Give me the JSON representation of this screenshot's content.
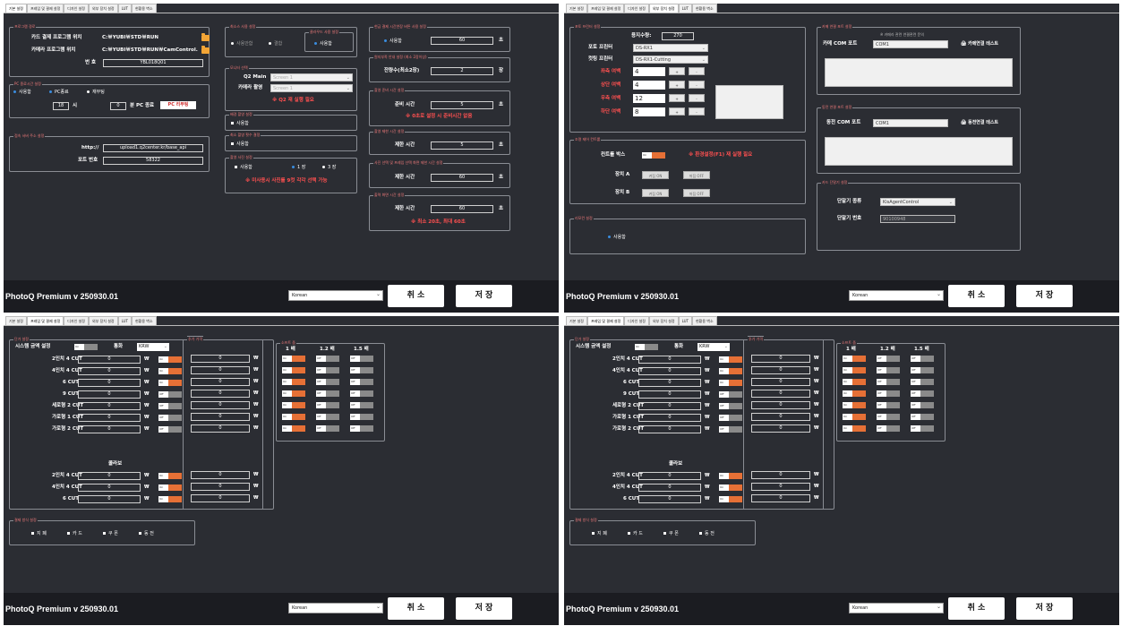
{
  "tabs": [
    "기본 설정",
    "프레임 및 결제 설정",
    "디자인 설정",
    "외부 장치 설정",
    "LUT",
    "현황용 벽소"
  ],
  "footer": {
    "version": "PhotoQ Premium v 250930.01",
    "language": "Korean",
    "cancel": "취 소",
    "save": "저 장"
  },
  "q1": {
    "program": {
      "title": "프로그램 경로",
      "card_label": "카드 결제 프로그램 위치",
      "card_path": "C:￦YUBI￦STD￦RUN",
      "camera_label": "카메라 프로그램 위치",
      "camera_path": "C:￦YUBI￦STD￦RUN￦CamControl.",
      "number_label": "번 호",
      "number_value": "YBL018Q01"
    },
    "pc": {
      "title": "PC 종료시간 설정",
      "use": "사용함",
      "shutdown": "PC종료",
      "reboot": "재부팅",
      "hour": "18",
      "hour_unit": "시",
      "min": "0",
      "min_unit": "분 PC 종료",
      "reboot_btn": "PC 리부팅"
    },
    "server": {
      "title": "접속 서버 주소 설정",
      "http_label": "http://",
      "url": "upload1.q2center.kr/base_api",
      "port_label": "포트 번호",
      "port": "58322"
    },
    "cut_photo": {
      "title": "최소스 사용 설정",
      "opt1": "사용안함",
      "opt2": "결합",
      "sub_title": "클라우드 사용 설정",
      "sub_opt": "사용함"
    },
    "monitor": {
      "title": "모니터 선택",
      "main_label": "Q2 Main",
      "main_value": "Screen 1",
      "camera_label": "카메라 촬영",
      "camera_value": "Screen 1",
      "warn": "※ Q2 재 실행 필요"
    },
    "bg": {
      "title": "배경 촬영 설정",
      "opt": "사용함"
    },
    "min_count": {
      "title": "최소 촬영 횟수 결정",
      "opt": "사용함"
    },
    "shoot": {
      "title": "촬영 사진 설정",
      "use": "사용함",
      "one": "1 장",
      "three": "3 장",
      "warn": "※ 미사용시 사진를 9컷 각각 선택 가능"
    },
    "cash": {
      "title": "현금 결제 시간연장 버튼 사용 설정",
      "use": "사용함",
      "value": "60",
      "unit": "초"
    },
    "paper": {
      "title": "원지부족 안내 설정 (최소 2장이상)",
      "label": "잔량수(최소2장)",
      "value": "2",
      "unit": "장"
    },
    "prep": {
      "title": "촬영 준비 시간 설정",
      "label": "준비 시간",
      "value": "5",
      "unit": "초",
      "warn": "※ 0초로 설정 시 준비시간 없음"
    },
    "limit": {
      "title": "촬영 제한 시간 설정",
      "label": "제한 시간",
      "value": "5",
      "unit": "초"
    },
    "select": {
      "title": "사진 선택 및 프레임 선택 화면 제한 시간 설정",
      "label": "제한 시간",
      "value": "60",
      "unit": "초"
    },
    "print": {
      "title": "출력 화면 시간 설정",
      "label": "제한 시간",
      "value": "60",
      "unit": "초",
      "warn": "※ 최소 20초, 최대 60초"
    }
  },
  "q2": {
    "photo": {
      "title": "포토 프린터 설정",
      "qty_label": "용지수량:",
      "qty": "270",
      "photo_printer_label": "포토 프린터",
      "photo_printer": "DS-RX1",
      "cut_printer_label": "컷팅 프린터",
      "cut_printer": "DS-RX1-Cutting",
      "margins": [
        {
          "label": "좌측 여백",
          "value": "4"
        },
        {
          "label": "상단 여백",
          "value": "4"
        },
        {
          "label": "우측 여백",
          "value": "12"
        },
        {
          "label": "하단 여백",
          "value": "8"
        }
      ],
      "plus": "+",
      "minus": "-"
    },
    "light": {
      "title": "조명 제어 컨트롤",
      "box_label": "컨트롤 박스",
      "warn": "※ 환경설정(F1) 재 실행 필요",
      "a_label": "장치 A",
      "b_label": "장치 B",
      "on": "켜짐 ON",
      "off": "꺼짐 OFF"
    },
    "remote": {
      "title": "리모컨 설정",
      "opt": "사용함"
    },
    "camera_com": {
      "title": "카메 연결 포트 설정",
      "note": "※ 카메라 관련 연결관련 문의",
      "label": "카메 COM 포트",
      "port": "COM1",
      "test": "카메연결 테스트"
    },
    "coin_com": {
      "title": "동전 연결 포트 설정",
      "label": "동전 COM 포트",
      "port": "COM1",
      "test": "동전연결 테스트"
    },
    "card": {
      "title": "카드 단말기 설정",
      "type_label": "단말기 종류",
      "type": "KisAgentControl",
      "num_label": "단말기 번호",
      "num": "90100948"
    }
  },
  "pricing": {
    "title": "단가 설정",
    "sys_label": "시스템 금액 설정",
    "currency_label": "통화",
    "currency": "KRW",
    "extra_title": "추가 가격",
    "zoom_title": "소프트 줌",
    "zoom_cols": [
      "1 배",
      "1.2 배",
      "1.5 배"
    ],
    "rows": [
      {
        "label": "2인치 4 CUT",
        "value": "0",
        "on": true,
        "extra": "0",
        "zoom": [
          true,
          false,
          false
        ]
      },
      {
        "label": "4인치 4 CUT",
        "value": "0",
        "on": true,
        "extra": "0",
        "zoom": [
          true,
          false,
          false
        ]
      },
      {
        "label": "6 CUT",
        "value": "0",
        "on": true,
        "extra": "0",
        "zoom": [
          true,
          false,
          false
        ]
      },
      {
        "label": "9 CUT",
        "value": "0",
        "on": false,
        "extra": "0",
        "zoom": [
          true,
          false,
          false
        ]
      },
      {
        "label": "세로형 2 CUT",
        "value": "0",
        "on": false,
        "extra": "0",
        "zoom": [
          true,
          false,
          false
        ]
      },
      {
        "label": "가로형 1 CUT",
        "value": "0",
        "on": false,
        "extra": "0",
        "zoom": [
          true,
          false,
          false
        ]
      },
      {
        "label": "가로형 2 CUT",
        "value": "0",
        "on": false,
        "extra": "0",
        "zoom": [
          true,
          false,
          false
        ]
      }
    ],
    "collage_label": "콜라보",
    "collage_rows": [
      {
        "label": "2인치 4 CUT",
        "value": "0",
        "on": true,
        "extra": "0"
      },
      {
        "label": "4인치 4 CUT",
        "value": "0",
        "on": true,
        "extra": "0"
      },
      {
        "label": "6 CUT",
        "value": "0",
        "on": true,
        "extra": "0"
      }
    ],
    "won": "₩",
    "toggle_on": "On",
    "toggle_off": "Off",
    "pay_title": "결제 방식 설정",
    "pay": [
      "지 폐",
      "카 드",
      "쿠 폰",
      "동 전"
    ]
  },
  "colors": {
    "bg": "#2b2d33",
    "accent_orange": "#e67036",
    "group_title": "#f07a7a",
    "warn_red": "#ff5050",
    "radio_blue": "#3a8de0",
    "footer": "#1b1c21"
  }
}
